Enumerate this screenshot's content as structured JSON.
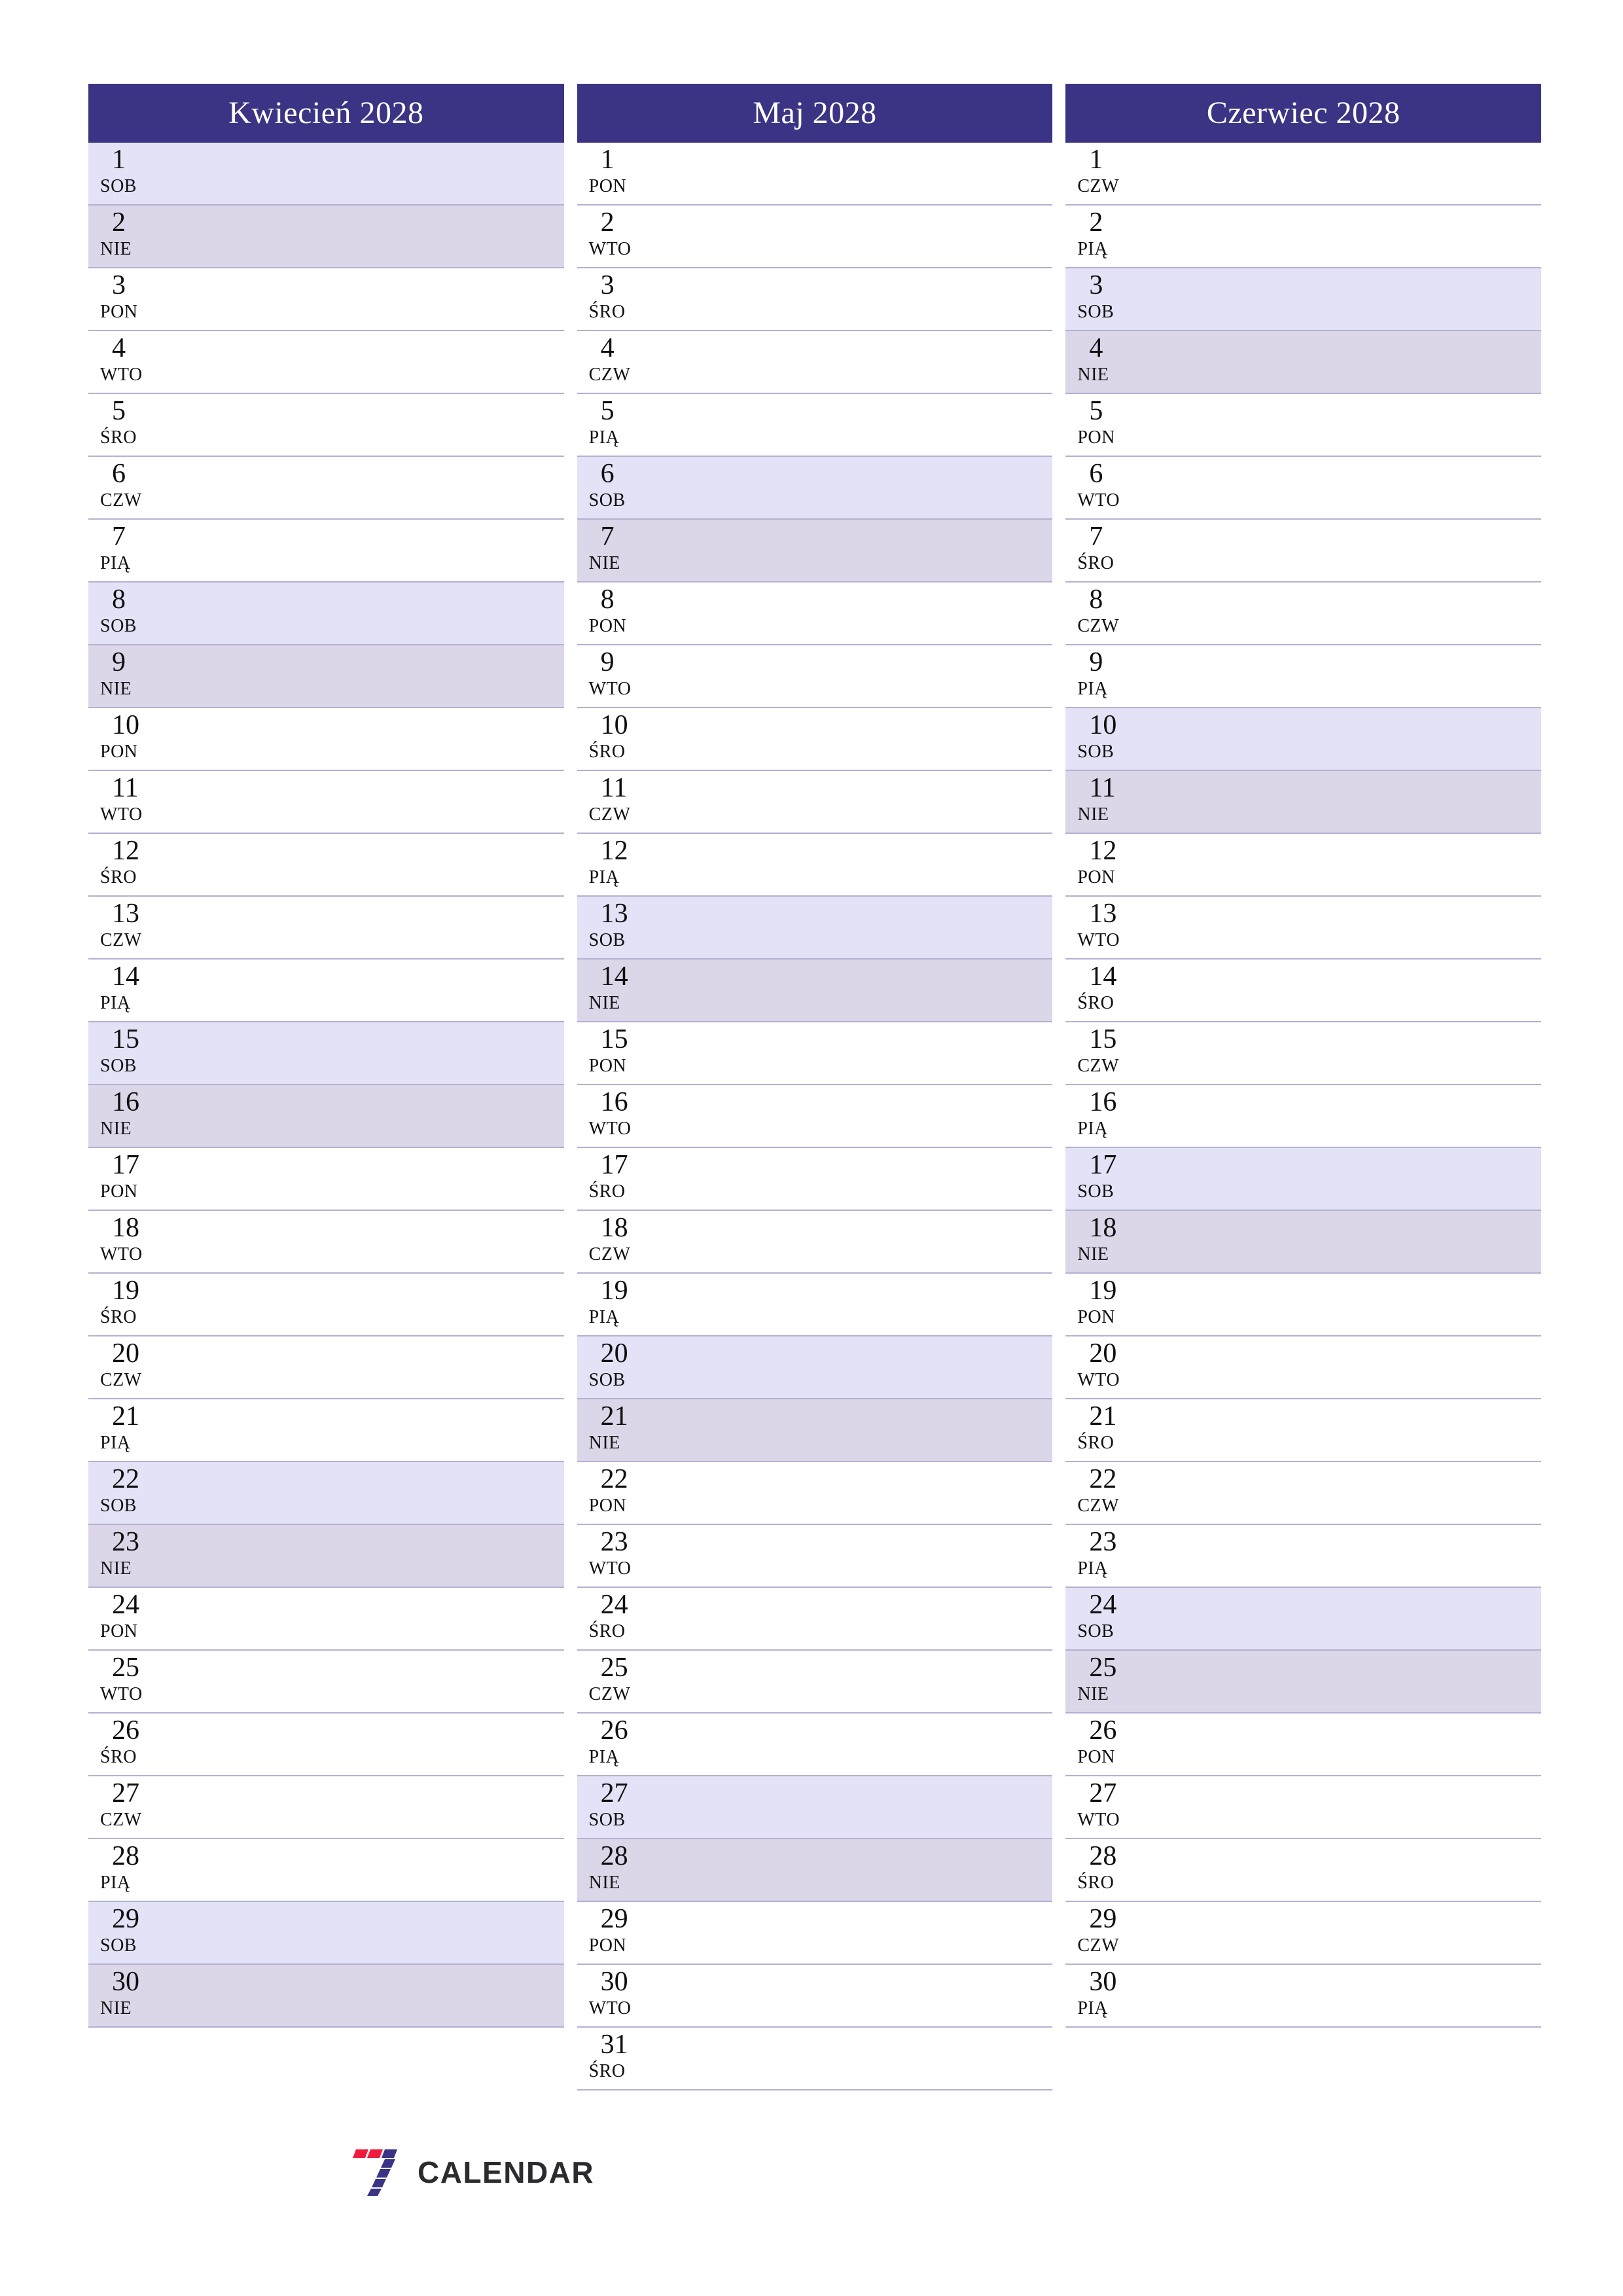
{
  "page": {
    "language": "pl",
    "accent_header_color": "#3b3484",
    "saturday_color": "#e3e2f6",
    "sunday_color": "#dcd6e9",
    "row_divider_color": "#b5b0d2",
    "weekday_abbreviations": {
      "monday": "PON",
      "tuesday": "WTO",
      "wednesday": "ŚRO",
      "thursday": "CZW",
      "friday": "PIĄ",
      "saturday": "SOB",
      "sunday": "NIE"
    }
  },
  "brand": {
    "name": "CALENDAR",
    "mark": "seven-logo-icon",
    "mark_colors": {
      "red": "#f01b3c",
      "navy": "#3b3484"
    }
  },
  "months": [
    {
      "title": "Kwiecień 2028",
      "name": "Kwiecień",
      "year": "2028",
      "days": [
        {
          "num": "1",
          "abbr": "SOB",
          "type": "sat"
        },
        {
          "num": "2",
          "abbr": "NIE",
          "type": "sun"
        },
        {
          "num": "3",
          "abbr": "PON",
          "type": "weekday"
        },
        {
          "num": "4",
          "abbr": "WTO",
          "type": "weekday"
        },
        {
          "num": "5",
          "abbr": "ŚRO",
          "type": "weekday"
        },
        {
          "num": "6",
          "abbr": "CZW",
          "type": "weekday"
        },
        {
          "num": "7",
          "abbr": "PIĄ",
          "type": "weekday"
        },
        {
          "num": "8",
          "abbr": "SOB",
          "type": "sat"
        },
        {
          "num": "9",
          "abbr": "NIE",
          "type": "sun"
        },
        {
          "num": "10",
          "abbr": "PON",
          "type": "weekday"
        },
        {
          "num": "11",
          "abbr": "WTO",
          "type": "weekday"
        },
        {
          "num": "12",
          "abbr": "ŚRO",
          "type": "weekday"
        },
        {
          "num": "13",
          "abbr": "CZW",
          "type": "weekday"
        },
        {
          "num": "14",
          "abbr": "PIĄ",
          "type": "weekday"
        },
        {
          "num": "15",
          "abbr": "SOB",
          "type": "sat"
        },
        {
          "num": "16",
          "abbr": "NIE",
          "type": "sun"
        },
        {
          "num": "17",
          "abbr": "PON",
          "type": "weekday"
        },
        {
          "num": "18",
          "abbr": "WTO",
          "type": "weekday"
        },
        {
          "num": "19",
          "abbr": "ŚRO",
          "type": "weekday"
        },
        {
          "num": "20",
          "abbr": "CZW",
          "type": "weekday"
        },
        {
          "num": "21",
          "abbr": "PIĄ",
          "type": "weekday"
        },
        {
          "num": "22",
          "abbr": "SOB",
          "type": "sat"
        },
        {
          "num": "23",
          "abbr": "NIE",
          "type": "sun"
        },
        {
          "num": "24",
          "abbr": "PON",
          "type": "weekday"
        },
        {
          "num": "25",
          "abbr": "WTO",
          "type": "weekday"
        },
        {
          "num": "26",
          "abbr": "ŚRO",
          "type": "weekday"
        },
        {
          "num": "27",
          "abbr": "CZW",
          "type": "weekday"
        },
        {
          "num": "28",
          "abbr": "PIĄ",
          "type": "weekday"
        },
        {
          "num": "29",
          "abbr": "SOB",
          "type": "sat"
        },
        {
          "num": "30",
          "abbr": "NIE",
          "type": "sun"
        }
      ]
    },
    {
      "title": "Maj 2028",
      "name": "Maj",
      "year": "2028",
      "days": [
        {
          "num": "1",
          "abbr": "PON",
          "type": "weekday"
        },
        {
          "num": "2",
          "abbr": "WTO",
          "type": "weekday"
        },
        {
          "num": "3",
          "abbr": "ŚRO",
          "type": "weekday"
        },
        {
          "num": "4",
          "abbr": "CZW",
          "type": "weekday"
        },
        {
          "num": "5",
          "abbr": "PIĄ",
          "type": "weekday"
        },
        {
          "num": "6",
          "abbr": "SOB",
          "type": "sat"
        },
        {
          "num": "7",
          "abbr": "NIE",
          "type": "sun"
        },
        {
          "num": "8",
          "abbr": "PON",
          "type": "weekday"
        },
        {
          "num": "9",
          "abbr": "WTO",
          "type": "weekday"
        },
        {
          "num": "10",
          "abbr": "ŚRO",
          "type": "weekday"
        },
        {
          "num": "11",
          "abbr": "CZW",
          "type": "weekday"
        },
        {
          "num": "12",
          "abbr": "PIĄ",
          "type": "weekday"
        },
        {
          "num": "13",
          "abbr": "SOB",
          "type": "sat"
        },
        {
          "num": "14",
          "abbr": "NIE",
          "type": "sun"
        },
        {
          "num": "15",
          "abbr": "PON",
          "type": "weekday"
        },
        {
          "num": "16",
          "abbr": "WTO",
          "type": "weekday"
        },
        {
          "num": "17",
          "abbr": "ŚRO",
          "type": "weekday"
        },
        {
          "num": "18",
          "abbr": "CZW",
          "type": "weekday"
        },
        {
          "num": "19",
          "abbr": "PIĄ",
          "type": "weekday"
        },
        {
          "num": "20",
          "abbr": "SOB",
          "type": "sat"
        },
        {
          "num": "21",
          "abbr": "NIE",
          "type": "sun"
        },
        {
          "num": "22",
          "abbr": "PON",
          "type": "weekday"
        },
        {
          "num": "23",
          "abbr": "WTO",
          "type": "weekday"
        },
        {
          "num": "24",
          "abbr": "ŚRO",
          "type": "weekday"
        },
        {
          "num": "25",
          "abbr": "CZW",
          "type": "weekday"
        },
        {
          "num": "26",
          "abbr": "PIĄ",
          "type": "weekday"
        },
        {
          "num": "27",
          "abbr": "SOB",
          "type": "sat"
        },
        {
          "num": "28",
          "abbr": "NIE",
          "type": "sun"
        },
        {
          "num": "29",
          "abbr": "PON",
          "type": "weekday"
        },
        {
          "num": "30",
          "abbr": "WTO",
          "type": "weekday"
        },
        {
          "num": "31",
          "abbr": "ŚRO",
          "type": "weekday"
        }
      ]
    },
    {
      "title": "Czerwiec 2028",
      "name": "Czerwiec",
      "year": "2028",
      "days": [
        {
          "num": "1",
          "abbr": "CZW",
          "type": "weekday"
        },
        {
          "num": "2",
          "abbr": "PIĄ",
          "type": "weekday"
        },
        {
          "num": "3",
          "abbr": "SOB",
          "type": "sat"
        },
        {
          "num": "4",
          "abbr": "NIE",
          "type": "sun"
        },
        {
          "num": "5",
          "abbr": "PON",
          "type": "weekday"
        },
        {
          "num": "6",
          "abbr": "WTO",
          "type": "weekday"
        },
        {
          "num": "7",
          "abbr": "ŚRO",
          "type": "weekday"
        },
        {
          "num": "8",
          "abbr": "CZW",
          "type": "weekday"
        },
        {
          "num": "9",
          "abbr": "PIĄ",
          "type": "weekday"
        },
        {
          "num": "10",
          "abbr": "SOB",
          "type": "sat"
        },
        {
          "num": "11",
          "abbr": "NIE",
          "type": "sun"
        },
        {
          "num": "12",
          "abbr": "PON",
          "type": "weekday"
        },
        {
          "num": "13",
          "abbr": "WTO",
          "type": "weekday"
        },
        {
          "num": "14",
          "abbr": "ŚRO",
          "type": "weekday"
        },
        {
          "num": "15",
          "abbr": "CZW",
          "type": "weekday"
        },
        {
          "num": "16",
          "abbr": "PIĄ",
          "type": "weekday"
        },
        {
          "num": "17",
          "abbr": "SOB",
          "type": "sat"
        },
        {
          "num": "18",
          "abbr": "NIE",
          "type": "sun"
        },
        {
          "num": "19",
          "abbr": "PON",
          "type": "weekday"
        },
        {
          "num": "20",
          "abbr": "WTO",
          "type": "weekday"
        },
        {
          "num": "21",
          "abbr": "ŚRO",
          "type": "weekday"
        },
        {
          "num": "22",
          "abbr": "CZW",
          "type": "weekday"
        },
        {
          "num": "23",
          "abbr": "PIĄ",
          "type": "weekday"
        },
        {
          "num": "24",
          "abbr": "SOB",
          "type": "sat"
        },
        {
          "num": "25",
          "abbr": "NIE",
          "type": "sun"
        },
        {
          "num": "26",
          "abbr": "PON",
          "type": "weekday"
        },
        {
          "num": "27",
          "abbr": "WTO",
          "type": "weekday"
        },
        {
          "num": "28",
          "abbr": "ŚRO",
          "type": "weekday"
        },
        {
          "num": "29",
          "abbr": "CZW",
          "type": "weekday"
        },
        {
          "num": "30",
          "abbr": "PIĄ",
          "type": "weekday"
        }
      ]
    }
  ]
}
